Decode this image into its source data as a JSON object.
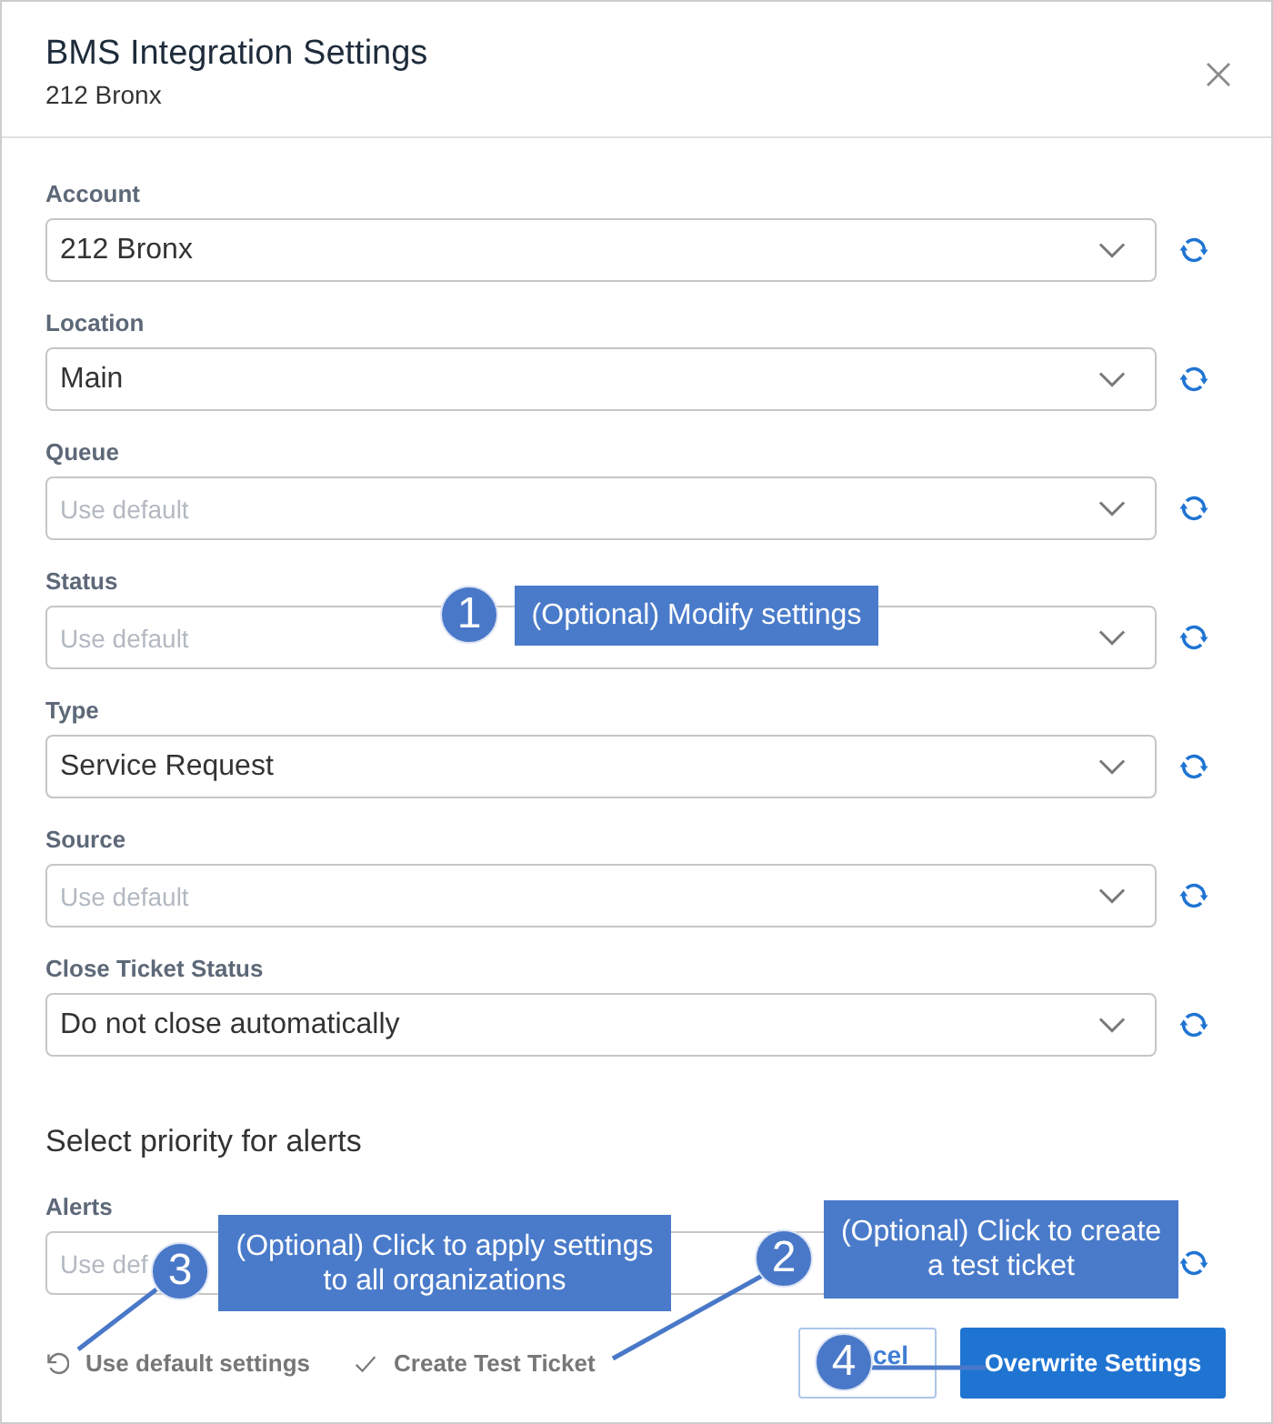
{
  "dialog": {
    "title": "BMS Integration Settings",
    "subtitle": "212 Bronx"
  },
  "fields": [
    {
      "label": "Account",
      "value": "212 Bronx"
    },
    {
      "label": "Location",
      "value": "Main"
    },
    {
      "label": "Queue",
      "placeholder": "Use default"
    },
    {
      "label": "Status",
      "placeholder": "Use default"
    },
    {
      "label": "Type",
      "value": "Service Request"
    },
    {
      "label": "Source",
      "placeholder": "Use default"
    },
    {
      "label": "Close Ticket Status",
      "value": "Do not close automatically"
    }
  ],
  "priority": {
    "heading": "Select priority for alerts",
    "fields": [
      {
        "label": "Alerts",
        "placeholder": "Use def"
      }
    ]
  },
  "footer": {
    "links": [
      {
        "kind": "reset",
        "label": "Use default settings"
      },
      {
        "kind": "test",
        "label": "Create Test Ticket"
      }
    ],
    "buttons": [
      {
        "kind": "secondary",
        "label": "cel"
      },
      {
        "kind": "primary",
        "label": "Overwrite Settings"
      }
    ]
  },
  "callouts": [
    {
      "number": "1",
      "text": "(Optional) Modify settings"
    },
    {
      "number": "2",
      "text": "(Optional) Click to create a test ticket"
    },
    {
      "number": "3",
      "text": "(Optional) Click to apply settings to all organizations"
    },
    {
      "number": "4"
    }
  ]
}
